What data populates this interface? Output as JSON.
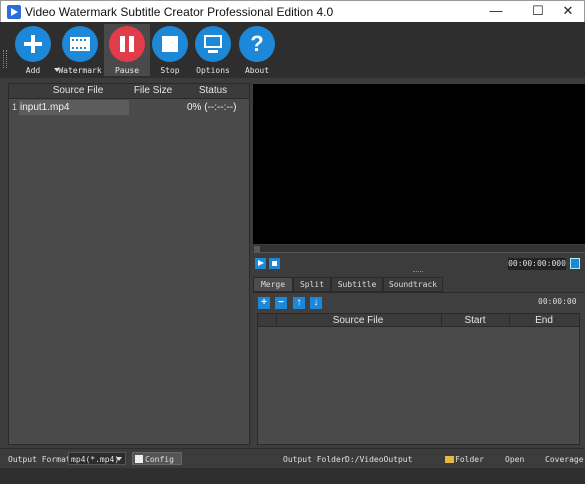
{
  "window": {
    "title": "Video Watermark Subtitle Creator Professional Edition 4.0",
    "minimize": "—",
    "maximize": "☐",
    "close": "✕"
  },
  "toolbar": {
    "add": "Add",
    "watermark": "Watermark",
    "pause": "Pause",
    "stop": "Stop",
    "options": "Options",
    "about": "About",
    "about_glyph": "?"
  },
  "file_table": {
    "headers": {
      "source_file": "Source File",
      "file_size": "File Size",
      "status": "Status"
    },
    "rows": [
      {
        "index": "1",
        "source_file": "input1.mp4",
        "file_size": "",
        "status": "0% (--:--:--)"
      }
    ]
  },
  "player": {
    "time": "00:00:00:000"
  },
  "tabs": {
    "merge": "Merge",
    "split": "Split",
    "subtitle": "Subtitle",
    "soundtrack": "Soundtrack"
  },
  "merge": {
    "buttons": {
      "add": "+",
      "remove": "−",
      "up": "↑",
      "down": "↓"
    },
    "time": "00:00:00",
    "headers": {
      "source_file": "Source File",
      "start": "Start",
      "end": "End"
    }
  },
  "bottom": {
    "output_format_label": "Output Format",
    "output_format_value": "mp4(*.mp4)",
    "config_label": "Config",
    "output_folder_label": "Output Folder",
    "output_folder_value": "D:/VideoOutput",
    "folder_label": "Folder",
    "open_label": "Open",
    "coverage_label": "Coverage"
  },
  "colors": {
    "accent": "#1e88d8",
    "pause_red": "#e23b4a",
    "panel": "#4a4a4a",
    "background": "#3c3c3c"
  }
}
